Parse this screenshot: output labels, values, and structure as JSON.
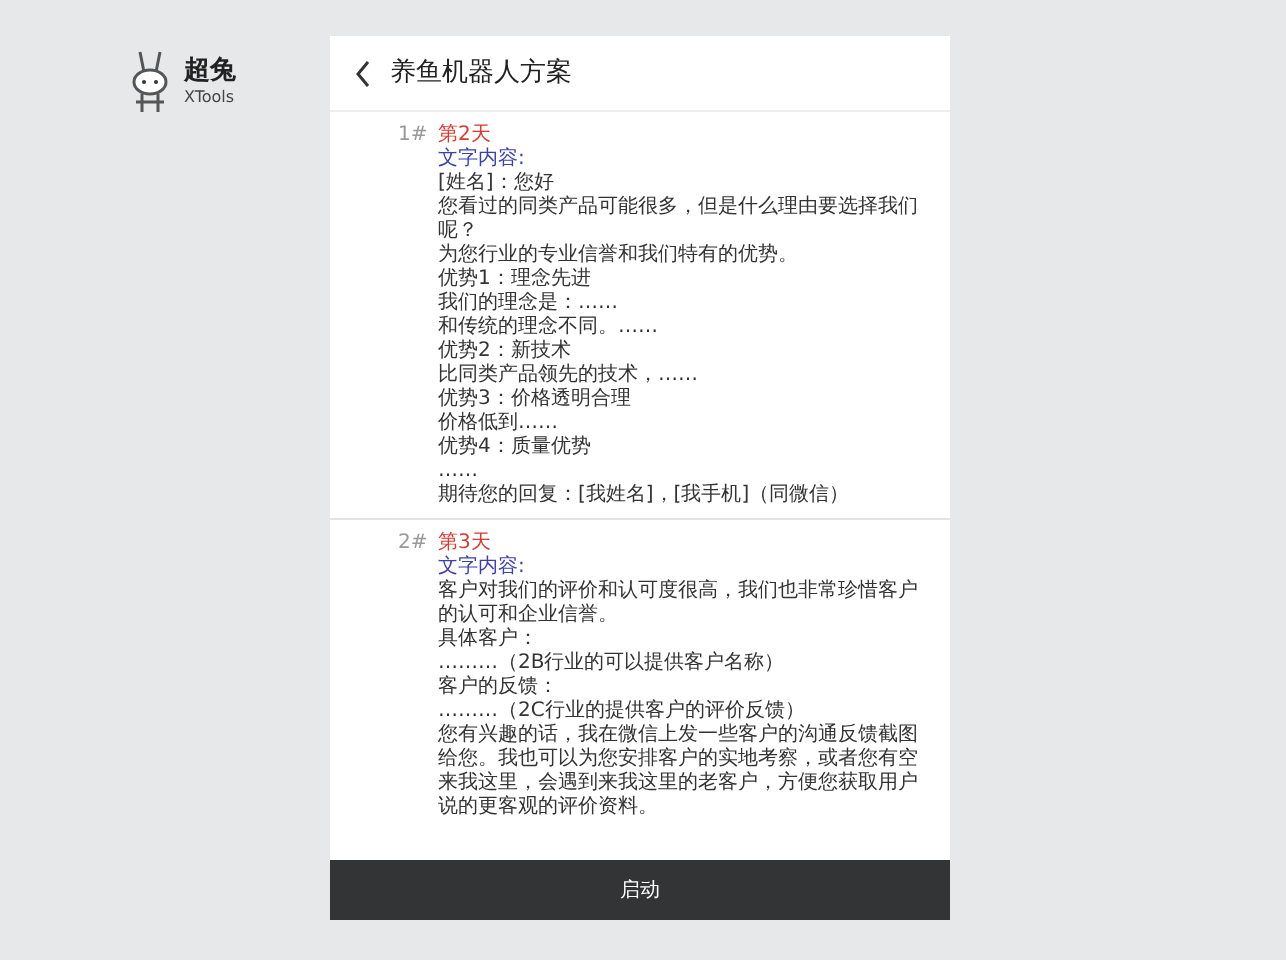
{
  "logo": {
    "name": "超兔",
    "sub": "XTools"
  },
  "header": {
    "title": "养鱼机器人方案"
  },
  "items": [
    {
      "number": "1#",
      "day": "第2天",
      "label": "文字内容:",
      "lines": [
        "[姓名]：您好",
        "您看过的同类产品可能很多，但是什么理由要选择我们呢？",
        "为您行业的专业信誉和我们特有的优势。",
        "优势1：理念先进",
        "我们的理念是：……",
        "和传统的理念不同。……",
        "优势2：新技术",
        "比同类产品领先的技术，……",
        "优势3：价格透明合理",
        "价格低到……",
        "优势4：质量优势",
        "……",
        "期待您的回复：[我姓名]，[我手机]（同微信）"
      ]
    },
    {
      "number": "2#",
      "day": "第3天",
      "label": "文字内容:",
      "lines": [
        "客户对我们的评价和认可度很高，我们也非常珍惜客户的认可和企业信誉。",
        "具体客户：",
        "………（2B行业的可以提供客户名称）",
        "客户的反馈：",
        "………（2C行业的提供客户的评价反馈）",
        "您有兴趣的话，我在微信上发一些客户的沟通反馈截图给您。我也可以为您安排客户的实地考察，或者您有空来我这里，会遇到来我这里的老客户，方便您获取用户说的更客观的评价资料。"
      ]
    }
  ],
  "button": "启动"
}
